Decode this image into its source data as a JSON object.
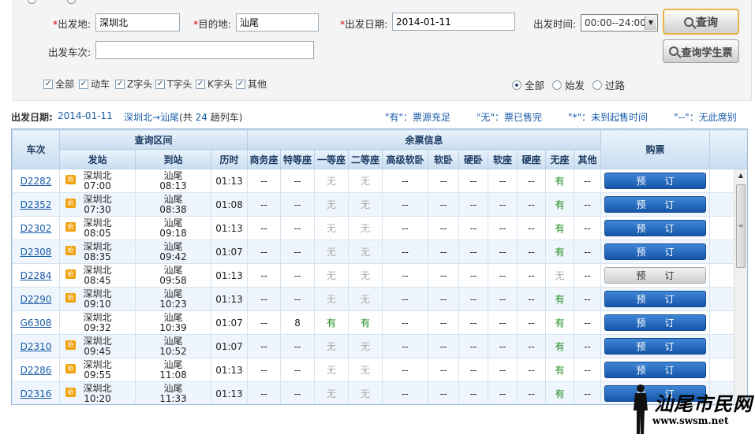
{
  "search": {
    "from_label": "出发地:",
    "from_value": "深圳北",
    "to_label": "目的地:",
    "to_value": "汕尾",
    "date_label": "出发日期:",
    "date_value": "2014-01-11",
    "time_label": "出发时间:",
    "time_value": "00:00--24:00",
    "train_no_label": "出发车次:",
    "train_no_value": "",
    "query_button": "查询",
    "student_button": "查询学生票",
    "req_mark": "*"
  },
  "filters": {
    "types": [
      {
        "label": "全部",
        "checked": true
      },
      {
        "label": "动车",
        "checked": true
      },
      {
        "label": "Z字头",
        "checked": true
      },
      {
        "label": "T字头",
        "checked": true
      },
      {
        "label": "K字头",
        "checked": true
      },
      {
        "label": "其他",
        "checked": true
      }
    ],
    "station_types": [
      {
        "label": "全部",
        "selected": true
      },
      {
        "label": "始发",
        "selected": false
      },
      {
        "label": "过路",
        "selected": false
      }
    ]
  },
  "summary": {
    "date_label": "出发日期:",
    "date_value": "2014-01-11",
    "route": "深圳北→汕尾",
    "count_prefix": "(共",
    "count": "24",
    "count_suffix": "趟列车)",
    "legend_you": "\"有\"：票源充足",
    "legend_wu": "\"无\"：票已售完",
    "legend_star": "\"*\"：未到起售时间",
    "legend_dash": "\"--\"：无此席别"
  },
  "table": {
    "headers": {
      "train": "车次",
      "range": "查询区间",
      "from": "发站",
      "to": "到站",
      "duration": "历时",
      "tickets": "余票信息",
      "book": "购票"
    },
    "seat_headers": [
      "商务座",
      "特等座",
      "一等座",
      "二等座",
      "高级软卧",
      "软卧",
      "硬卧",
      "软座",
      "硬座",
      "无座",
      "其他"
    ],
    "start_badge": "始",
    "book_label": "预订",
    "rows": [
      {
        "train": "D2282",
        "start": true,
        "from": "深圳北",
        "dep": "07:00",
        "to": "汕尾",
        "arr": "08:13",
        "dur": "01:13",
        "seats": [
          "--",
          "--",
          "无",
          "无",
          "--",
          "--",
          "--",
          "--",
          "--",
          "有",
          "--"
        ],
        "bookable": true
      },
      {
        "train": "D2352",
        "start": true,
        "from": "深圳北",
        "dep": "07:30",
        "to": "汕尾",
        "arr": "08:38",
        "dur": "01:08",
        "seats": [
          "--",
          "--",
          "无",
          "无",
          "--",
          "--",
          "--",
          "--",
          "--",
          "有",
          "--"
        ],
        "bookable": true
      },
      {
        "train": "D2302",
        "start": true,
        "from": "深圳北",
        "dep": "08:05",
        "to": "汕尾",
        "arr": "09:18",
        "dur": "01:13",
        "seats": [
          "--",
          "--",
          "无",
          "无",
          "--",
          "--",
          "--",
          "--",
          "--",
          "有",
          "--"
        ],
        "bookable": true
      },
      {
        "train": "D2308",
        "start": true,
        "from": "深圳北",
        "dep": "08:35",
        "to": "汕尾",
        "arr": "09:42",
        "dur": "01:07",
        "seats": [
          "--",
          "--",
          "无",
          "无",
          "--",
          "--",
          "--",
          "--",
          "--",
          "有",
          "--"
        ],
        "bookable": true
      },
      {
        "train": "D2284",
        "start": true,
        "from": "深圳北",
        "dep": "08:45",
        "to": "汕尾",
        "arr": "09:58",
        "dur": "01:13",
        "seats": [
          "--",
          "--",
          "无",
          "无",
          "--",
          "--",
          "--",
          "--",
          "--",
          "无",
          "--"
        ],
        "bookable": false
      },
      {
        "train": "D2290",
        "start": true,
        "from": "深圳北",
        "dep": "09:10",
        "to": "汕尾",
        "arr": "10:23",
        "dur": "01:13",
        "seats": [
          "--",
          "--",
          "无",
          "无",
          "--",
          "--",
          "--",
          "--",
          "--",
          "有",
          "--"
        ],
        "bookable": true
      },
      {
        "train": "G6308",
        "start": false,
        "from": "深圳北",
        "dep": "09:32",
        "to": "汕尾",
        "arr": "10:39",
        "dur": "01:07",
        "seats": [
          "--",
          "8",
          "有",
          "有",
          "--",
          "--",
          "--",
          "--",
          "--",
          "有",
          "--"
        ],
        "bookable": true
      },
      {
        "train": "D2310",
        "start": true,
        "from": "深圳北",
        "dep": "09:45",
        "to": "汕尾",
        "arr": "10:52",
        "dur": "01:07",
        "seats": [
          "--",
          "--",
          "无",
          "无",
          "--",
          "--",
          "--",
          "--",
          "--",
          "有",
          "--"
        ],
        "bookable": true
      },
      {
        "train": "D2286",
        "start": true,
        "from": "深圳北",
        "dep": "09:55",
        "to": "汕尾",
        "arr": "11:08",
        "dur": "01:13",
        "seats": [
          "--",
          "--",
          "无",
          "无",
          "--",
          "--",
          "--",
          "--",
          "--",
          "有",
          "--"
        ],
        "bookable": true
      },
      {
        "train": "D2316",
        "start": true,
        "from": "深圳北",
        "dep": "10:20",
        "to": "汕尾",
        "arr": "11:33",
        "dur": "01:13",
        "seats": [
          "--",
          "--",
          "无",
          "无",
          "--",
          "--",
          "--",
          "--",
          "--",
          "有",
          "--"
        ],
        "bookable": true
      }
    ]
  },
  "watermark": {
    "title": "汕尾市民网",
    "url": "www.swsm.net"
  },
  "colors": {
    "header_blue": "#c9ddf1",
    "book_button": "#1656a8",
    "available_green": "#1a8c1a",
    "link_blue": "#1a5ca8"
  }
}
